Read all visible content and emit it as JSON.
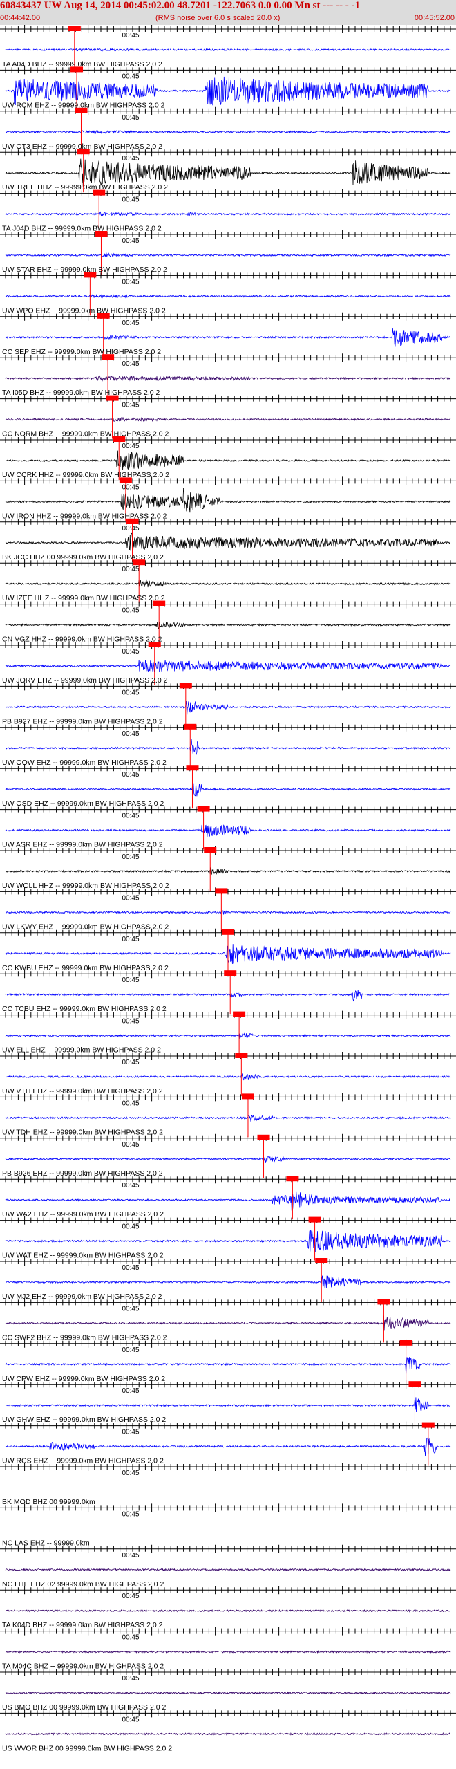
{
  "header": {
    "title": "60843437 UW Aug 14, 2014 00:45:02.00   48.7201 -122.7063  0.0 0.00 Mn st --- -- -  -1",
    "start_time": "00:44:42.00",
    "note": "(RMS noise over 6.0 s scaled 20.0 x)",
    "end_time": "00:45:52.00"
  },
  "colors": {
    "header_bg": "#dcdcdc",
    "header_text": "#cc0000",
    "trace_blue": "#0000ff",
    "trace_black": "#000000",
    "trace_purple": "#330066",
    "pick": "#ff0000"
  },
  "chart_data": {
    "type": "line",
    "x_unit": "s",
    "x_range": [
      "00:44:42.00",
      "00:45:52.00"
    ],
    "tick_label": "00:45",
    "traces": [
      {
        "label": "TA A04D BHZ -- 99999.0km BW  HIGHPASS  2.0  2",
        "color": "blue",
        "pick": 0.155,
        "bursts": [
          [
            0.155,
            0.3,
            0.5
          ]
        ]
      },
      {
        "label": "UW RCM EHZ -- 99999.0km BW  HIGHPASS  2.0  2",
        "color": "blue",
        "pick": 0.16,
        "bursts": [
          [
            0.02,
            0.34,
            20
          ],
          [
            0.45,
            0.95,
            22
          ]
        ]
      },
      {
        "label": "UW OT3 EHZ -- 99999.0km BW  HIGHPASS  2.0  2",
        "color": "blue",
        "pick": 0.17,
        "bursts": [
          [
            0.17,
            0.3,
            1.2
          ]
        ]
      },
      {
        "label": "UW TREE HHZ -- 99999.0km BW  HIGHPASS  2.0  2",
        "color": "black",
        "pick": 0.175,
        "bursts": [
          [
            0.165,
            0.55,
            20
          ],
          [
            0.78,
            0.95,
            18
          ]
        ]
      },
      {
        "label": "TA J04D BHZ -- 99999.0km BW  HIGHPASS  2.0  2",
        "color": "blue",
        "pick": 0.21,
        "bursts": [
          [
            0.21,
            0.3,
            2
          ],
          [
            0.41,
            0.43,
            2.5
          ]
        ]
      },
      {
        "label": "UW STAR EHZ -- 99999.0km BW  HIGHPASS  2.0  2",
        "color": "blue",
        "pick": 0.215,
        "bursts": [
          [
            0.215,
            0.3,
            1.5
          ]
        ]
      },
      {
        "label": "UW WPO EHZ -- 99999.0km BW  HIGHPASS  2.0  2",
        "color": "blue",
        "pick": 0.19,
        "bursts": [
          [
            0.19,
            0.3,
            1.2
          ]
        ]
      },
      {
        "label": "CC SEP EHZ -- 99999.0km BW  HIGHPASS  2.0  2",
        "color": "blue",
        "pick": 0.22,
        "bursts": [
          [
            0.22,
            0.3,
            2
          ],
          [
            0.87,
            0.98,
            14
          ]
        ]
      },
      {
        "label": "TA I05D BHZ -- 99999.0km BW  HIGHPASS  2.0  2",
        "color": "purple",
        "pick": 0.23,
        "bursts": [
          [
            0.2,
            0.55,
            3
          ]
        ]
      },
      {
        "label": "CC NORM BHZ -- 99999.0km BW  HIGHPASS  2.0  2",
        "color": "purple",
        "pick": 0.24,
        "bursts": [
          [
            0.24,
            0.35,
            2
          ]
        ]
      },
      {
        "label": "UW CCRK HHZ -- 99999.0km BW  HIGHPASS  2.0  2",
        "color": "black",
        "pick": 0.255,
        "bursts": [
          [
            0.25,
            0.4,
            16
          ]
        ]
      },
      {
        "label": "UW IRON HHZ -- 99999.0km BW  HIGHPASS  2.0  2",
        "color": "black",
        "pick": 0.27,
        "bursts": [
          [
            0.26,
            0.48,
            12
          ],
          [
            0.4,
            0.46,
            20
          ]
        ]
      },
      {
        "label": "BK JCC HHZ 00 99999.0km BW  HIGHPASS  2.0  2",
        "color": "black",
        "pick": 0.285,
        "bursts": [
          [
            0.27,
            0.98,
            10
          ],
          [
            0.28,
            0.32,
            14
          ]
        ]
      },
      {
        "label": "UW IZEE HHZ -- 99999.0km BW  HIGHPASS  2.0  2",
        "color": "black",
        "pick": 0.3,
        "bursts": [
          [
            0.3,
            0.36,
            6
          ]
        ]
      },
      {
        "label": "CN VGZ HHZ -- 99999.0km BW  HIGHPASS  2.0  2",
        "color": "black",
        "pick": 0.345,
        "bursts": [
          [
            0.34,
            0.4,
            5
          ]
        ]
      },
      {
        "label": "UW JORV EHZ -- 99999.0km BW  HIGHPASS  2.0  2",
        "color": "blue",
        "pick": 0.335,
        "bursts": [
          [
            0.3,
            0.98,
            8
          ]
        ]
      },
      {
        "label": "PB B927 EHZ -- 99999.0km BW  HIGHPASS  2.0  2",
        "color": "blue",
        "pick": 0.405,
        "bursts": [
          [
            0.405,
            0.43,
            16
          ],
          [
            0.43,
            0.5,
            4
          ]
        ]
      },
      {
        "label": "UW OOW EHZ -- 99999.0km BW  HIGHPASS  2.0  2",
        "color": "blue",
        "pick": 0.415,
        "bursts": [
          [
            0.415,
            0.435,
            18
          ]
        ]
      },
      {
        "label": "UW OSD EHZ -- 99999.0km BW  HIGHPASS  2.0  2",
        "color": "blue",
        "pick": 0.42,
        "bursts": [
          [
            0.42,
            0.44,
            16
          ]
        ]
      },
      {
        "label": "UW ASR EHZ -- 99999.0km BW  HIGHPASS  2.0  2",
        "color": "blue",
        "pick": 0.445,
        "bursts": [
          [
            0.44,
            0.55,
            12
          ]
        ]
      },
      {
        "label": "UW WOLL HHZ -- 99999.0km BW  HIGHPASS  2.0  2",
        "color": "black",
        "pick": 0.46,
        "bursts": [
          [
            0.46,
            0.5,
            5
          ]
        ]
      },
      {
        "label": "UW LKWY EHZ -- 99999.0km BW  HIGHPASS  2.0  2",
        "color": "blue",
        "pick": 0.485,
        "bursts": [
          [
            0.485,
            0.5,
            3
          ]
        ]
      },
      {
        "label": "CC KWBU EHZ -- 99999.0km BW  HIGHPASS  2.0  2",
        "color": "blue",
        "pick": 0.5,
        "bursts": [
          [
            0.49,
            0.98,
            12
          ],
          [
            0.5,
            0.56,
            18
          ]
        ]
      },
      {
        "label": "CC TCBU EHZ -- 99999.0km BW  HIGHPASS  2.0  2",
        "color": "blue",
        "pick": 0.505,
        "bursts": [
          [
            0.505,
            0.53,
            3
          ],
          [
            0.78,
            0.8,
            14
          ]
        ]
      },
      {
        "label": "UW ELL EHZ -- 99999.0km BW  HIGHPASS  2.0  2",
        "color": "blue",
        "pick": 0.525,
        "bursts": [
          [
            0.525,
            0.56,
            4
          ]
        ]
      },
      {
        "label": "UW VTH EHZ -- 99999.0km BW  HIGHPASS  2.0  2",
        "color": "blue",
        "pick": 0.53,
        "bursts": [
          [
            0.53,
            0.57,
            5
          ]
        ]
      },
      {
        "label": "UW TDH EHZ -- 99999.0km BW  HIGHPASS  2.0  2",
        "color": "blue",
        "pick": 0.545,
        "bursts": [
          [
            0.545,
            0.6,
            4
          ]
        ]
      },
      {
        "label": "PB B926 EHZ -- 99999.0km BW  HIGHPASS  2.0  2",
        "color": "blue",
        "pick": 0.58,
        "bursts": [
          [
            0.58,
            0.63,
            4
          ]
        ]
      },
      {
        "label": "UW WA2 EHZ -- 99999.0km BW  HIGHPASS  2.0  2",
        "color": "blue",
        "pick": 0.645,
        "bursts": [
          [
            0.6,
            0.98,
            6
          ],
          [
            0.64,
            0.7,
            16
          ]
        ]
      },
      {
        "label": "UW WAT EHZ -- 99999.0km BW  HIGHPASS  2.0  2",
        "color": "blue",
        "pick": 0.695,
        "bursts": [
          [
            0.68,
            0.98,
            16
          ]
        ]
      },
      {
        "label": "UW MJ2 EHZ -- 99999.0km BW  HIGHPASS  2.0  2",
        "color": "blue",
        "pick": 0.71,
        "bursts": [
          [
            0.71,
            0.8,
            10
          ]
        ]
      },
      {
        "label": "CC SWF2 BHZ -- 99999.0km BW  HIGHPASS  2.0  2",
        "color": "purple",
        "pick": 0.85,
        "bursts": [
          [
            0.85,
            0.95,
            10
          ]
        ]
      },
      {
        "label": "UW CPW EHZ -- 99999.0km BW  HIGHPASS  2.0  2",
        "color": "blue",
        "pick": 0.9,
        "bursts": [
          [
            0.9,
            0.93,
            14
          ]
        ]
      },
      {
        "label": "UW GHW EHZ -- 99999.0km BW  HIGHPASS  2.0  2",
        "color": "blue",
        "pick": 0.92,
        "bursts": [
          [
            0.92,
            0.95,
            12
          ]
        ]
      },
      {
        "label": "UW RCS EHZ -- 99999.0km BW  HIGHPASS  2.0  2",
        "color": "blue",
        "pick": 0.95,
        "bursts": [
          [
            0.94,
            0.97,
            18
          ],
          [
            0.1,
            0.2,
            6
          ]
        ]
      },
      {
        "label": "BK MOD BHZ 00 99999.0km",
        "color": "none",
        "pick": null,
        "bursts": []
      },
      {
        "label": "NC LAS EHZ -- 99999.0km",
        "color": "none",
        "pick": null,
        "bursts": []
      },
      {
        "label": "NC LHE EHZ 02 99999.0km BW  HIGHPASS  2.0  2",
        "color": "purple",
        "pick": null,
        "bursts": []
      },
      {
        "label": "TA K04D BHZ -- 99999.0km BW  HIGHPASS  2.0  2",
        "color": "purple",
        "pick": null,
        "bursts": []
      },
      {
        "label": "TA M04C BHZ -- 99999.0km BW  HIGHPASS  2.0  2",
        "color": "purple",
        "pick": null,
        "bursts": []
      },
      {
        "label": "US BMO BHZ 00 99999.0km BW  HIGHPASS  2.0  2",
        "color": "purple",
        "pick": null,
        "bursts": []
      },
      {
        "label": "US WVOR BHZ 00 99999.0km BW  HIGHPASS  2.0  2",
        "color": "purple",
        "pick": null,
        "bursts": []
      }
    ]
  }
}
